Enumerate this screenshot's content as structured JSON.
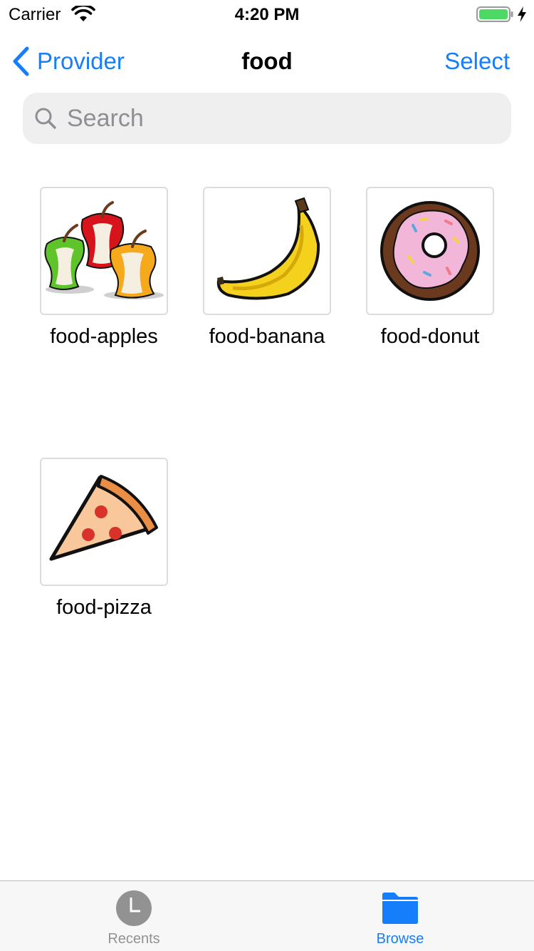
{
  "status_bar": {
    "carrier": "Carrier",
    "time": "4:20 PM",
    "battery_color": "#4cd964"
  },
  "nav": {
    "back_label": "Provider",
    "title": "food",
    "select_label": "Select"
  },
  "search": {
    "placeholder": "Search",
    "value": ""
  },
  "files": [
    {
      "name": "food-apples",
      "icon": "apples-image"
    },
    {
      "name": "food-banana",
      "icon": "banana-image"
    },
    {
      "name": "food-donut",
      "icon": "donut-image"
    },
    {
      "name": "food-pizza",
      "icon": "pizza-image"
    }
  ],
  "tabbar": {
    "recents_label": "Recents",
    "browse_label": "Browse",
    "active": "Browse",
    "accent": "#147efb",
    "inactive": "#929292"
  }
}
